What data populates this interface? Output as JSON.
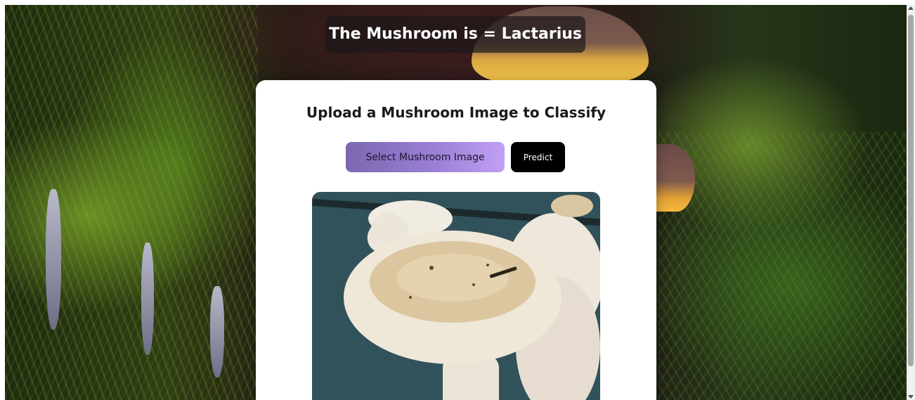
{
  "result": {
    "text": "The Mushroom is = Lactarius"
  },
  "card": {
    "title": "Upload a Mushroom Image to Classify",
    "select_label": "Select Mushroom Image",
    "predict_label": "Predict"
  },
  "preview": {
    "description_icon": "mushroom-image"
  },
  "colors": {
    "select_gradient_start": "#7a68b0",
    "select_gradient_end": "#c0a0f4",
    "predict_bg": "#000000",
    "card_bg": "#ffffff",
    "banner_bg": "#19161a"
  }
}
